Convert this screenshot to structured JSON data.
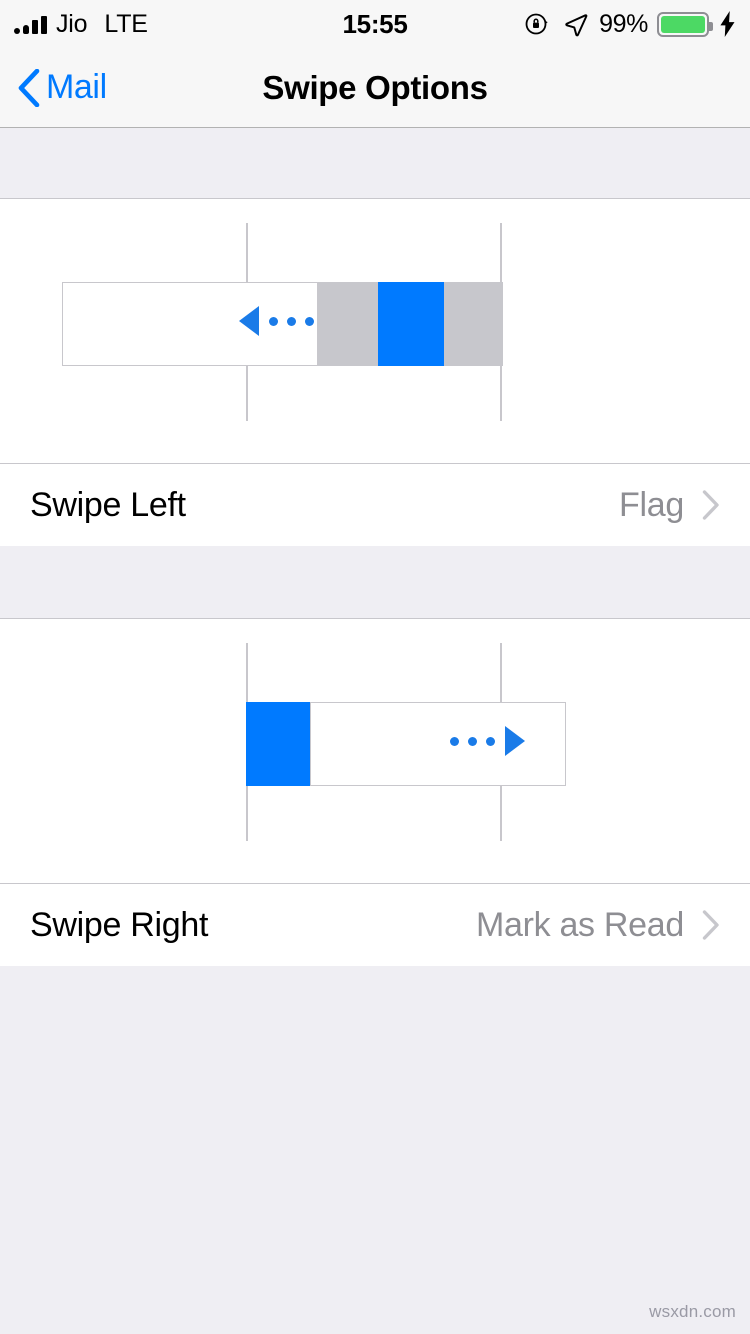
{
  "status_bar": {
    "signal_icon": "signal-bars-icon",
    "signal_bars_filled": 4,
    "carrier": "Jio",
    "radio": "LTE",
    "time": "15:55",
    "rotation_lock_icon": "rotation-lock-icon",
    "location_icon": "location-arrow-icon",
    "battery_percent": "99%",
    "battery_icon": "battery-icon",
    "battery_fill_color": "#4CD964",
    "charging_icon": "lightning-bolt-icon"
  },
  "nav_bar": {
    "back_icon": "chevron-left-icon",
    "back_label": "Mail",
    "title": "Swipe Options"
  },
  "sections": [
    {
      "name": "swipe-left-section",
      "illustration": {
        "name": "swipe-left-illustration",
        "direction": "left",
        "gesture_icon": "swipe-left-gesture-icon",
        "arrow_icon": "triangle-left-icon",
        "dots_icon": "ellipsis-icon"
      },
      "row": {
        "name": "swipe-left-row",
        "label": "Swipe Left",
        "value": "Flag",
        "disclosure_icon": "chevron-right-icon"
      }
    },
    {
      "name": "swipe-right-section",
      "illustration": {
        "name": "swipe-right-illustration",
        "direction": "right",
        "gesture_icon": "swipe-right-gesture-icon",
        "arrow_icon": "triangle-right-icon",
        "dots_icon": "ellipsis-icon"
      },
      "row": {
        "name": "swipe-right-row",
        "label": "Swipe Right",
        "value": "Mark as Read",
        "disclosure_icon": "chevron-right-icon"
      }
    }
  ],
  "colors": {
    "accent_blue": "#007AFF",
    "gesture_blue": "#1A7BE8",
    "action_gray": "#C7C7CC",
    "value_gray": "#8E8E93",
    "group_background": "#EFEEF3",
    "bar_background": "#F7F7F7"
  },
  "watermark": "wsxdn.com"
}
